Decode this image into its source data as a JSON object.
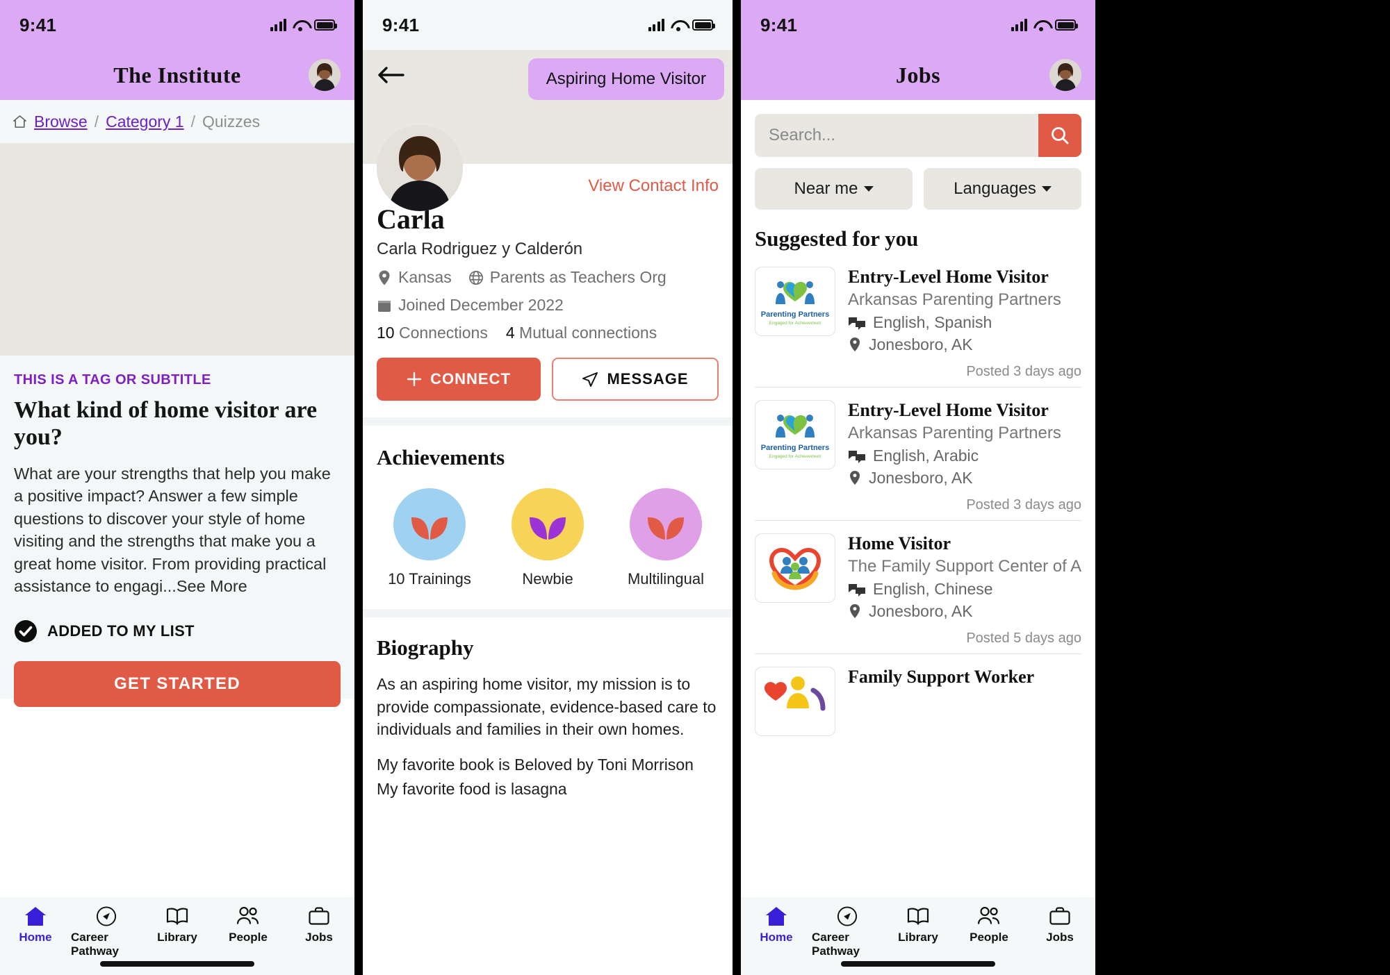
{
  "status_bar": {
    "time": "9:41"
  },
  "panel1": {
    "app_title": "The  Institute",
    "breadcrumb": {
      "home_icon": "home-icon",
      "items": [
        "Browse",
        "Category 1",
        "Quizzes"
      ],
      "separator": "/"
    },
    "quiz": {
      "tag": "THIS IS A TAG OR SUBTITLE",
      "title": "What kind of home visitor are you?",
      "description": "What are your strengths that help you make a positive impact? Answer a few simple questions to discover your style of home visiting and the strengths that make you a great home visitor. From providing practical assistance to engagi...See More",
      "added_label": "ADDED TO MY LIST",
      "cta_label": "GET STARTED"
    },
    "tabbar": [
      {
        "label": "Home",
        "icon": "home-icon",
        "active": true
      },
      {
        "label": "Career Pathway",
        "icon": "compass-icon",
        "active": false
      },
      {
        "label": "Library",
        "icon": "book-icon",
        "active": false
      },
      {
        "label": "People",
        "icon": "people-icon",
        "active": false
      },
      {
        "label": "Jobs",
        "icon": "briefcase-icon",
        "active": false
      }
    ]
  },
  "panel2": {
    "back_icon": "back-arrow-icon",
    "role_badge": "Aspiring Home Visitor",
    "view_contact": "View Contact Info",
    "name": "Carla",
    "full_name": "Carla Rodriguez y Calderón",
    "location": "Kansas",
    "organization": "Parents as Teachers Org",
    "joined": "Joined December 2022",
    "connections_count": "10",
    "connections_label": "Connections",
    "mutual_count": "4",
    "mutual_label": "Mutual connections",
    "connect_label": "CONNECT",
    "message_label": "MESSAGE",
    "achievements_title": "Achievements",
    "achievements": [
      {
        "label": "10 Trainings",
        "circle_color": "#9ed2f0",
        "leaf_color": "#e05a46"
      },
      {
        "label": "Newbie",
        "circle_color": "#f7d458",
        "leaf_color": "#9b33d6"
      },
      {
        "label": "Multilingual",
        "circle_color": "#dfa0e8",
        "leaf_color": "#e05a46"
      }
    ],
    "biography_title": "Biography",
    "biography_p1": "As an aspiring home visitor, my mission is to provide compassionate, evidence-based care to individuals and families in their own homes.",
    "biography_p2": "My favorite book is Beloved by Toni Morrison",
    "biography_p3": "My favorite food is lasagna"
  },
  "panel3": {
    "app_title": "Jobs",
    "search_placeholder": "Search...",
    "search_icon": "search-icon",
    "filters": [
      {
        "label": "Near me"
      },
      {
        "label": "Languages"
      }
    ],
    "suggested_title": "Suggested for you",
    "jobs": [
      {
        "title": "Entry-Level Home Visitor",
        "org": "Arkansas Parenting Partners",
        "languages": "English, Spanish",
        "location": "Jonesboro, AK",
        "posted": "Posted 3 days ago",
        "logo": "parenting-partners-logo"
      },
      {
        "title": "Entry-Level Home Visitor",
        "org": "Arkansas Parenting Partners",
        "languages": "English, Arabic",
        "location": "Jonesboro, AK",
        "posted": "Posted 3 days ago",
        "logo": "parenting-partners-logo"
      },
      {
        "title": "Home Visitor",
        "org": "The Family Support Center of Arkans",
        "languages": "English, Chinese",
        "location": "Jonesboro, AK",
        "posted": "Posted 5 days ago",
        "logo": "family-support-heart-logo"
      },
      {
        "title": "Family Support Worker",
        "org": "",
        "languages": "",
        "location": "",
        "posted": "",
        "logo": "family-worker-logo"
      }
    ],
    "tabbar": [
      {
        "label": "Home",
        "icon": "home-icon",
        "active": true
      },
      {
        "label": "Career Pathway",
        "icon": "compass-icon",
        "active": false
      },
      {
        "label": "Library",
        "icon": "book-icon",
        "active": false
      },
      {
        "label": "People",
        "icon": "people-icon",
        "active": false
      },
      {
        "label": "Jobs",
        "icon": "briefcase-icon",
        "active": false
      }
    ]
  },
  "colors": {
    "accent": "#e05a46",
    "lilac": "#dcaaf5",
    "link_purple": "#6b21c8",
    "active_tab": "#3b1fd6"
  }
}
